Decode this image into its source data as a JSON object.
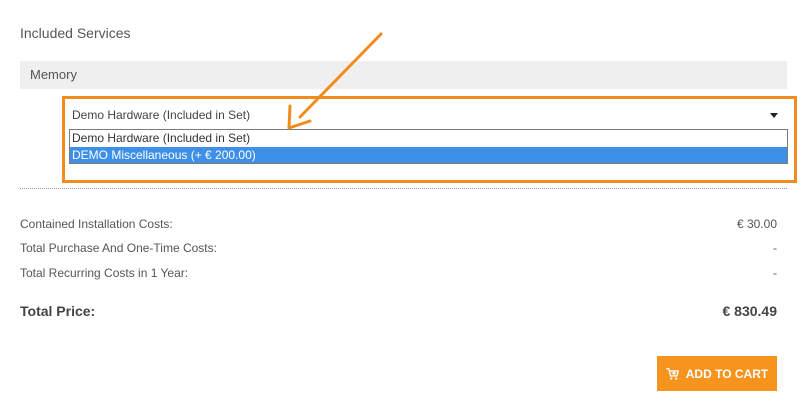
{
  "section": {
    "title": "Included Services"
  },
  "group": {
    "label": "Memory"
  },
  "select": {
    "selected_value": "Demo Hardware (Included in Set)",
    "options": [
      {
        "label": "Demo Hardware (Included in Set)",
        "highlighted": false
      },
      {
        "label": "DEMO Miscellaneous (+ € 200.00)",
        "highlighted": true
      }
    ]
  },
  "costs": [
    {
      "label": "Contained Installation Costs:",
      "value": "€ 30.00"
    },
    {
      "label": "Total Purchase And One-Time Costs:",
      "value": "-"
    },
    {
      "label": "Total Recurring Costs in 1 Year:",
      "value": "-"
    }
  ],
  "total": {
    "label": "Total Price:",
    "value": "€ 830.49"
  },
  "cart_button": {
    "label": "ADD TO CART",
    "icon": "cart-plus-icon"
  },
  "colors": {
    "accent_orange": "#f7941d",
    "annotation_orange": "#f08c1e",
    "option_highlight": "#3d8fe8",
    "group_bar_bg": "#efefef"
  }
}
